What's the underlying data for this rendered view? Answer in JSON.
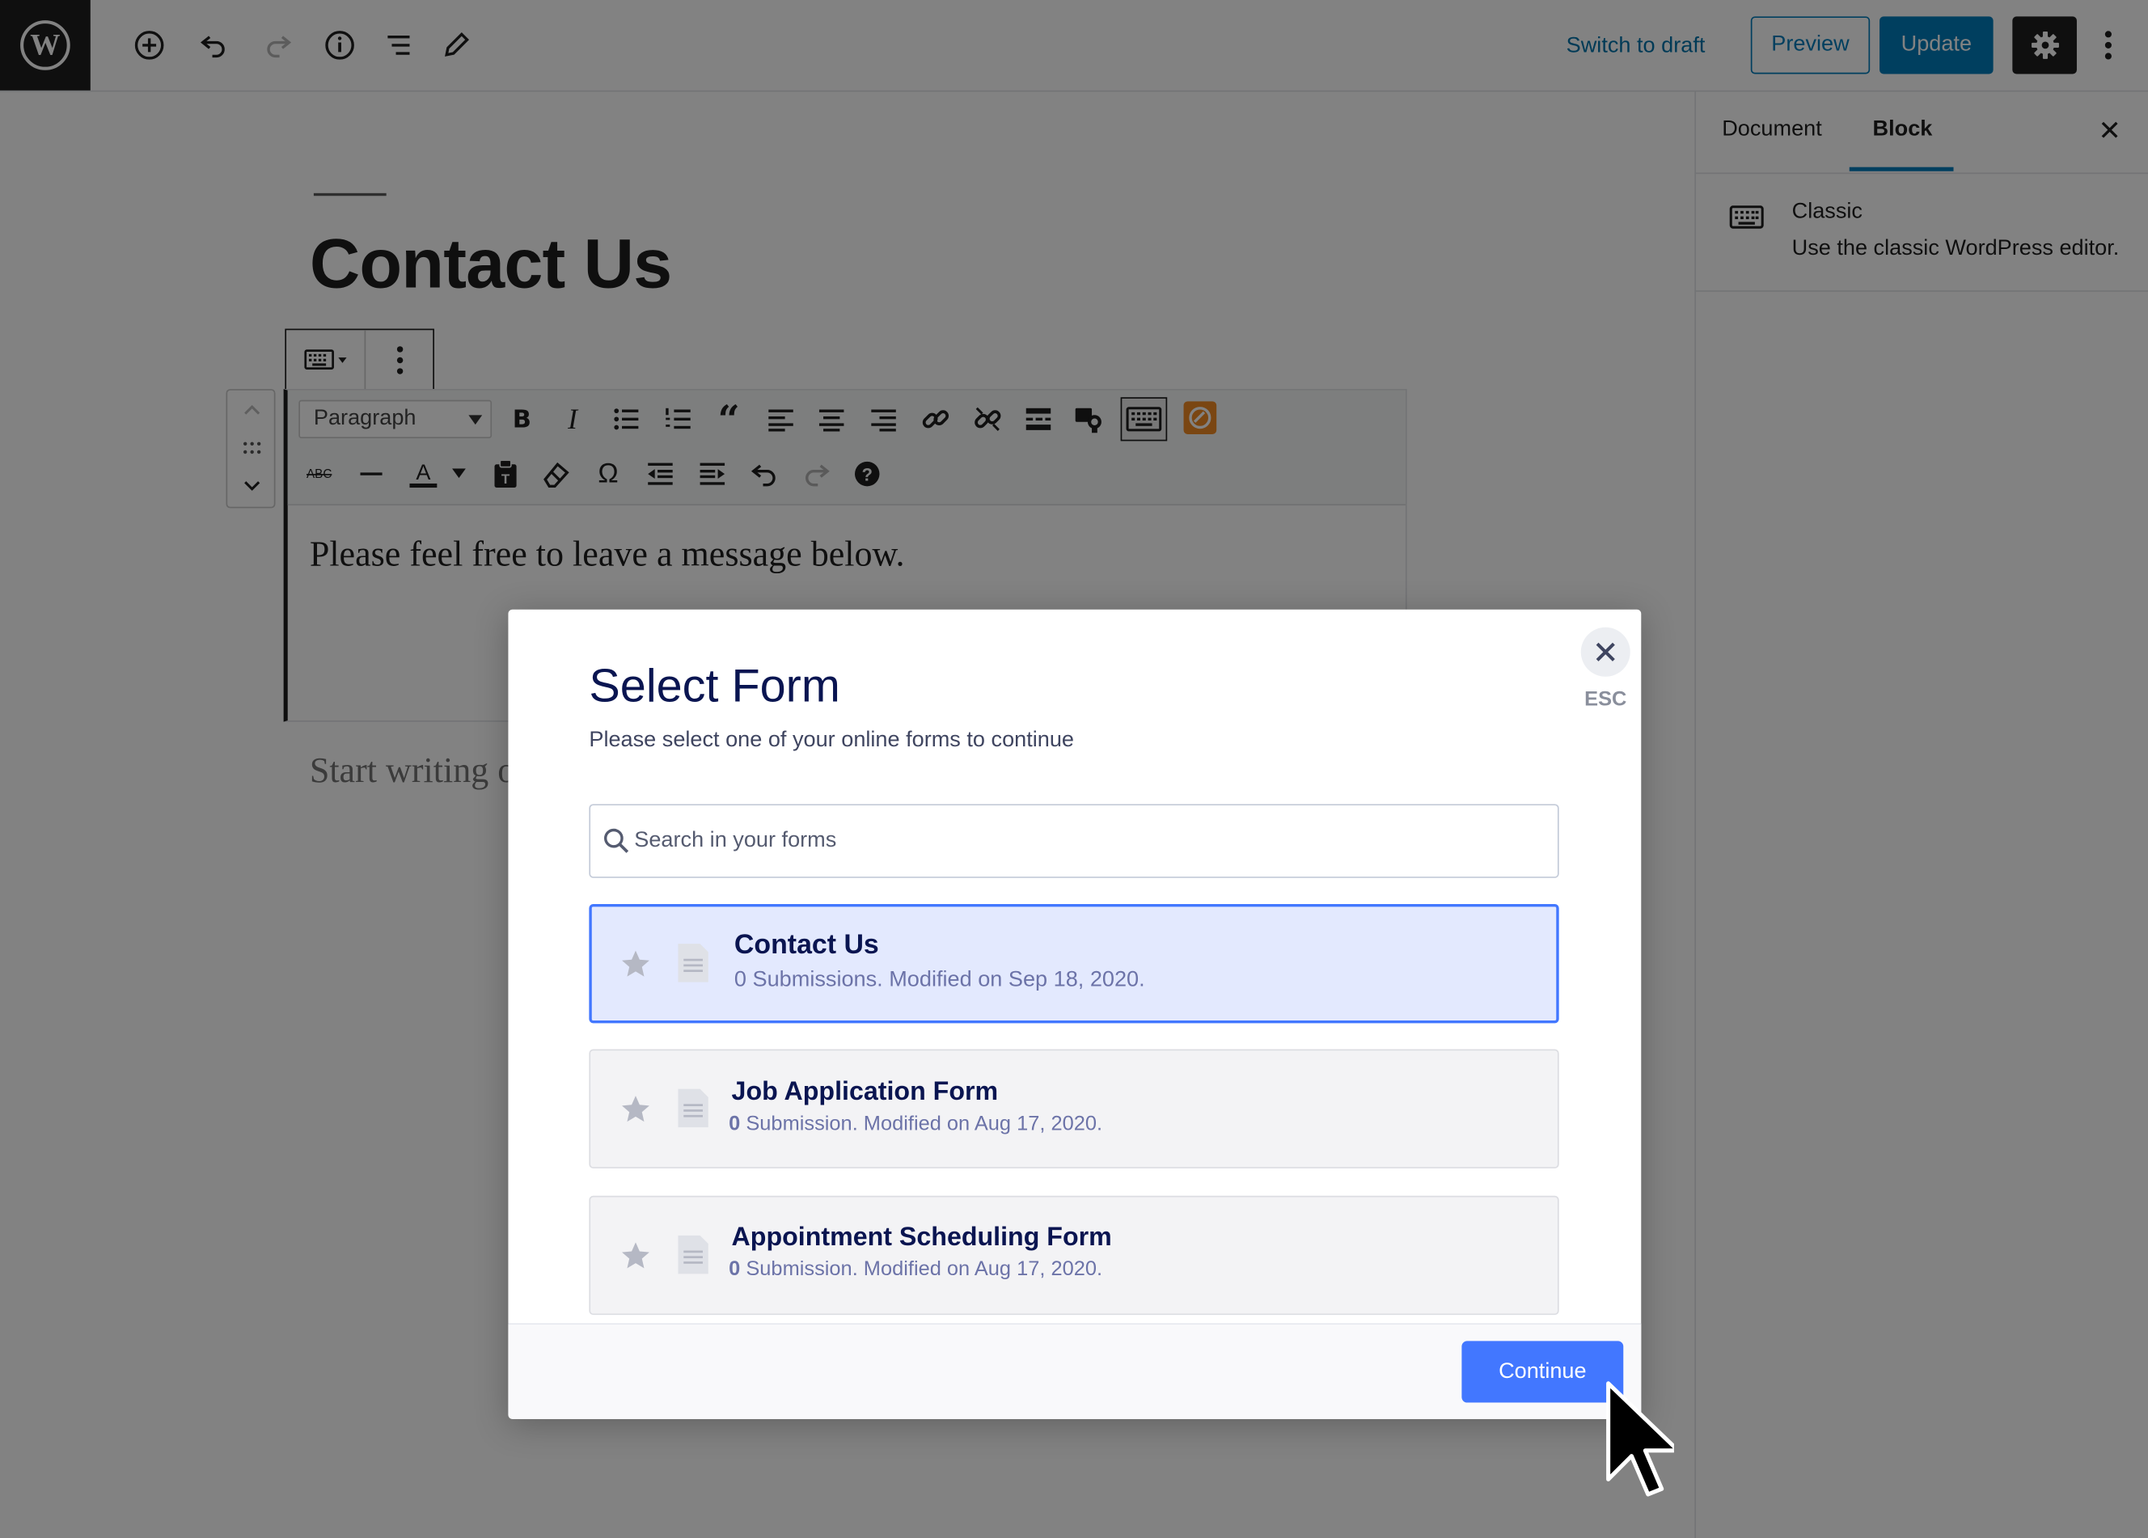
{
  "header": {
    "switch_to_draft": "Switch to draft",
    "preview": "Preview",
    "update": "Update",
    "toolbar_icons": [
      "wordpress-logo-icon",
      "add-block-icon",
      "undo-icon",
      "redo-icon",
      "info-icon",
      "block-navigation-icon",
      "tools-pencil-icon",
      "settings-gear-icon",
      "more-menu-icon"
    ]
  },
  "sidebar": {
    "tabs": [
      {
        "label": "Document"
      },
      {
        "label": "Block"
      }
    ],
    "active_tab": "Block",
    "close": "✕",
    "block_card": {
      "title": "Classic",
      "description": "Use the classic WordPress editor."
    }
  },
  "editor": {
    "title": "Contact Us",
    "format_select": "Paragraph",
    "content": "Please feel free to leave a message below.",
    "appender": "Start writing or type / to choose a block"
  },
  "modal": {
    "title": "Select Form",
    "subtitle": "Please select one of your online forms to continue",
    "close": "✕",
    "esc": "ESC",
    "search_placeholder": "Search in your forms",
    "forms": [
      {
        "title": "Contact Us",
        "meta": "0 Submissions. Modified on Sep 18, 2020.",
        "selected": true
      },
      {
        "title": "Job Application Form",
        "count": "0",
        "meta": "Submission. Modified on Aug 17, 2020.",
        "selected": false
      },
      {
        "title": "Appointment Scheduling Form",
        "count": "0",
        "meta": "Submission. Modified on Aug 17, 2020.",
        "selected": false
      }
    ],
    "continue": "Continue"
  },
  "colors": {
    "wp_blue": "#007cba",
    "jotform_blue": "#4277ff",
    "selected_bg": "#e3e9fe",
    "selected_border": "#4277ff",
    "title_navy": "#0a1551"
  }
}
